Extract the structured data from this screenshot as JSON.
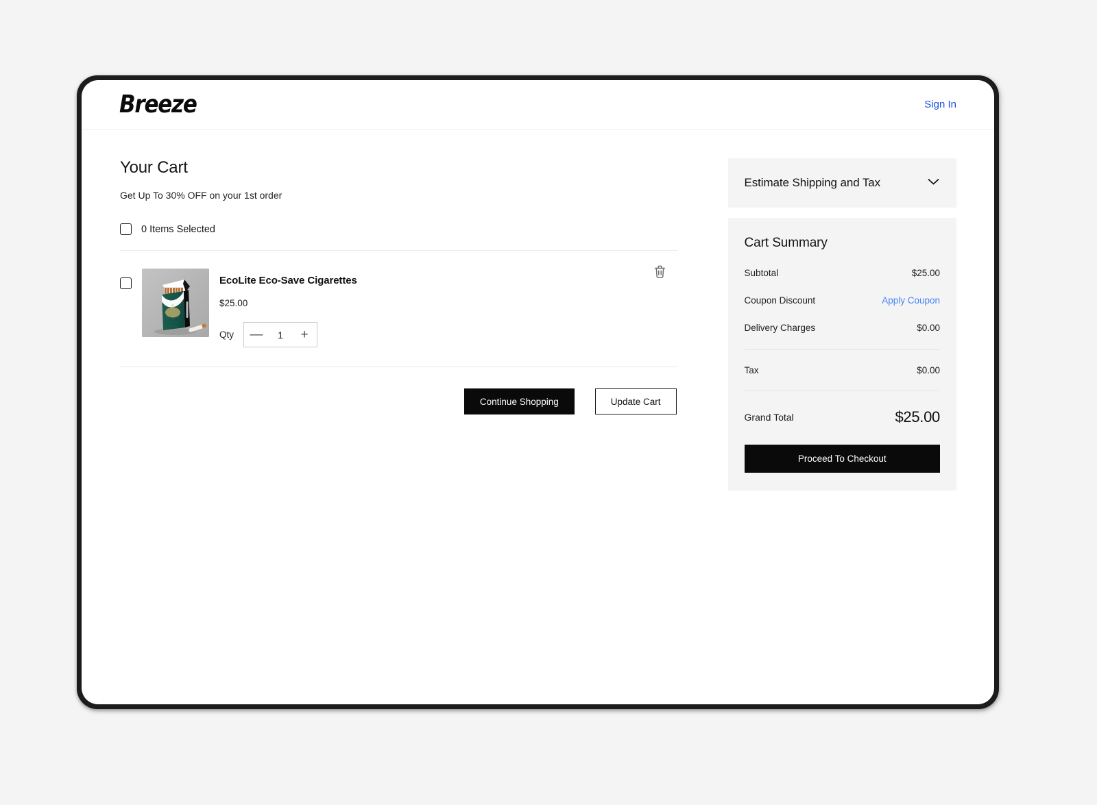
{
  "header": {
    "brand": "Breeze",
    "signin_label": "Sign In"
  },
  "cart": {
    "title": "Your Cart",
    "promo": "Get Up To 30% OFF on your 1st order",
    "select_all_label": "0 Items Selected",
    "items": [
      {
        "name": "EcoLite Eco-Save Cigarettes",
        "price": "$25.00",
        "qty_label": "Qty",
        "qty": "1",
        "decrement_label": "—",
        "increment_label": "+",
        "delete_icon": "trash-icon",
        "image_alt": "EcoLite Eco-Save Cigarettes pack"
      }
    ],
    "actions": {
      "continue_shopping": "Continue Shopping",
      "update_cart": "Update Cart"
    }
  },
  "estimate": {
    "title": "Estimate Shipping and Tax",
    "chevron_icon": "chevron-down-icon"
  },
  "summary": {
    "title": "Cart Summary",
    "rows": [
      {
        "label": "Subtotal",
        "value": "$25.00",
        "is_link": false
      },
      {
        "label": "Coupon Discount",
        "value": "Apply Coupon",
        "is_link": true
      },
      {
        "label": "Delivery Charges",
        "value": "$0.00",
        "is_link": false
      },
      {
        "label": "Tax",
        "value": "$0.00",
        "is_link": false
      }
    ],
    "grand_total_label": "Grand Total",
    "grand_total_value": "$25.00",
    "checkout_label": "Proceed To Checkout"
  },
  "colors": {
    "page_background": "#f4f4f5",
    "panel_background": "#f4f4f4",
    "accent_dark": "#0a0a0a",
    "link_blue": "#1a4fe0",
    "coupon_blue": "#4285f4",
    "device_bezel": "#1c1c1e"
  }
}
